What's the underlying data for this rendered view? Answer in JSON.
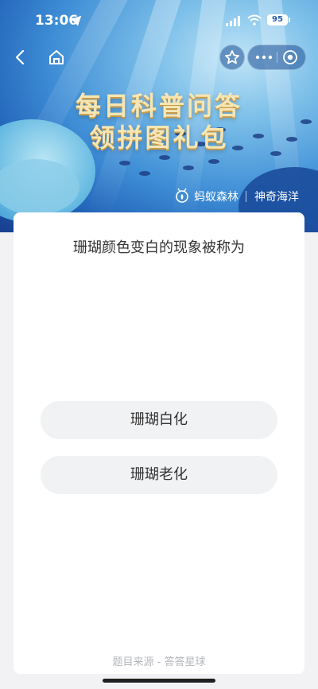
{
  "status_bar": {
    "time": "13:06",
    "battery": "95"
  },
  "banner": {
    "title_line1": "每日科普问答",
    "title_line2": "领拼图礼包",
    "brand_left": "蚂蚁森林",
    "brand_right": "神奇海洋"
  },
  "quiz": {
    "question": "珊瑚颜色变白的现象被称为",
    "options": [
      "珊瑚白化",
      "珊瑚老化"
    ]
  },
  "footer": {
    "source": "题目来源 - 答答星球"
  },
  "icons": {
    "back": "chevron-left-icon",
    "home": "home-icon",
    "favorite": "star-icon",
    "more": "more-icon",
    "close": "target-icon"
  },
  "colors": {
    "title_gold": "#f6e6b4",
    "banner_blue": "#2f74c8",
    "option_bg": "#f1f2f4"
  }
}
